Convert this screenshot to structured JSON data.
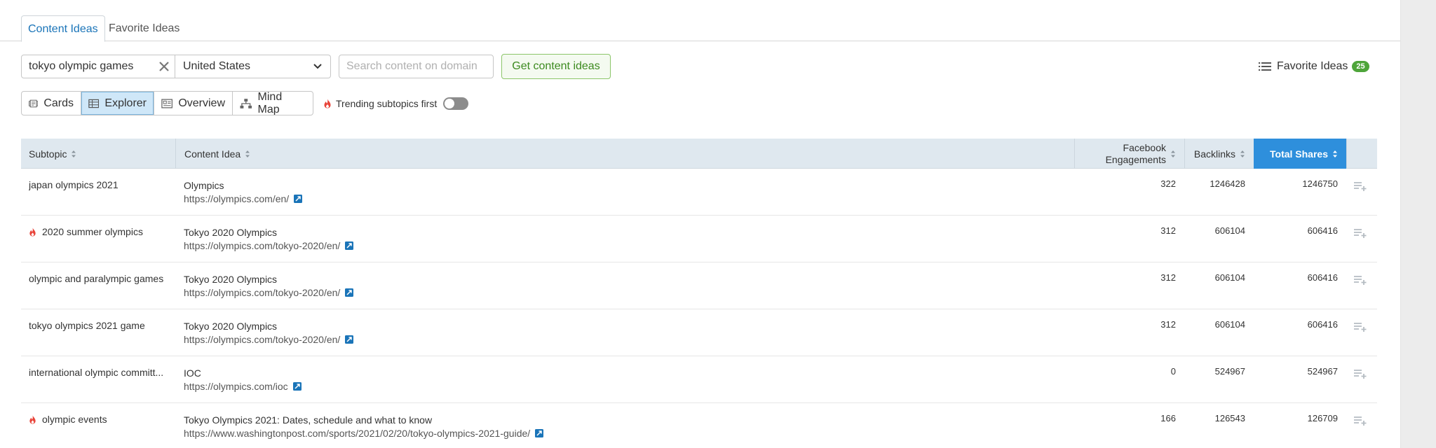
{
  "tabs": {
    "content_ideas": "Content Ideas",
    "favorite_ideas": "Favorite Ideas"
  },
  "search": {
    "value": "tokyo olympic games",
    "clear_icon": "close-icon"
  },
  "country": {
    "selected": "United States"
  },
  "domain_search": {
    "placeholder": "Search content on domain"
  },
  "get_ideas_label": "Get content ideas",
  "favorites": {
    "label": "Favorite Ideas",
    "count": "25"
  },
  "views": {
    "cards": "Cards",
    "explorer": "Explorer",
    "overview": "Overview",
    "mind_map": "Mind Map",
    "active": "Explorer"
  },
  "trending": {
    "label": "Trending subtopics first",
    "enabled": false
  },
  "table": {
    "headers": {
      "subtopic": "Subtopic",
      "content_idea": "Content Idea",
      "facebook_1": "Facebook",
      "facebook_2": "Engagements",
      "backlinks": "Backlinks",
      "total_shares": "Total Shares"
    },
    "rows": [
      {
        "subtopic": "japan olympics 2021",
        "trending": false,
        "title": "Olympics",
        "url": "https://olympics.com/en/",
        "facebook": "322",
        "backlinks": "1246428",
        "shares": "1246750"
      },
      {
        "subtopic": "2020 summer olympics",
        "trending": true,
        "title": "Tokyo 2020 Olympics",
        "url": "https://olympics.com/tokyo-2020/en/",
        "facebook": "312",
        "backlinks": "606104",
        "shares": "606416"
      },
      {
        "subtopic": "olympic and paralympic games",
        "trending": false,
        "title": "Tokyo 2020 Olympics",
        "url": "https://olympics.com/tokyo-2020/en/",
        "facebook": "312",
        "backlinks": "606104",
        "shares": "606416"
      },
      {
        "subtopic": "tokyo olympics 2021 game",
        "trending": false,
        "title": "Tokyo 2020 Olympics",
        "url": "https://olympics.com/tokyo-2020/en/",
        "facebook": "312",
        "backlinks": "606104",
        "shares": "606416"
      },
      {
        "subtopic": "international olympic committ...",
        "trending": false,
        "title": "IOC",
        "url": "https://olympics.com/ioc",
        "facebook": "0",
        "backlinks": "524967",
        "shares": "524967"
      },
      {
        "subtopic": "olympic events",
        "trending": true,
        "title": "Tokyo Olympics 2021: Dates, schedule and what to know",
        "url": "https://www.washingtonpost.com/sports/2021/02/20/tokyo-olympics-2021-guide/",
        "facebook": "166",
        "backlinks": "126543",
        "shares": "126709"
      }
    ]
  },
  "colors": {
    "accent": "#2e8fdc",
    "link_blue": "#1a74b8",
    "green": "#4ea53a",
    "fire": "#e8443a",
    "header_bg": "#dfe8ef"
  }
}
